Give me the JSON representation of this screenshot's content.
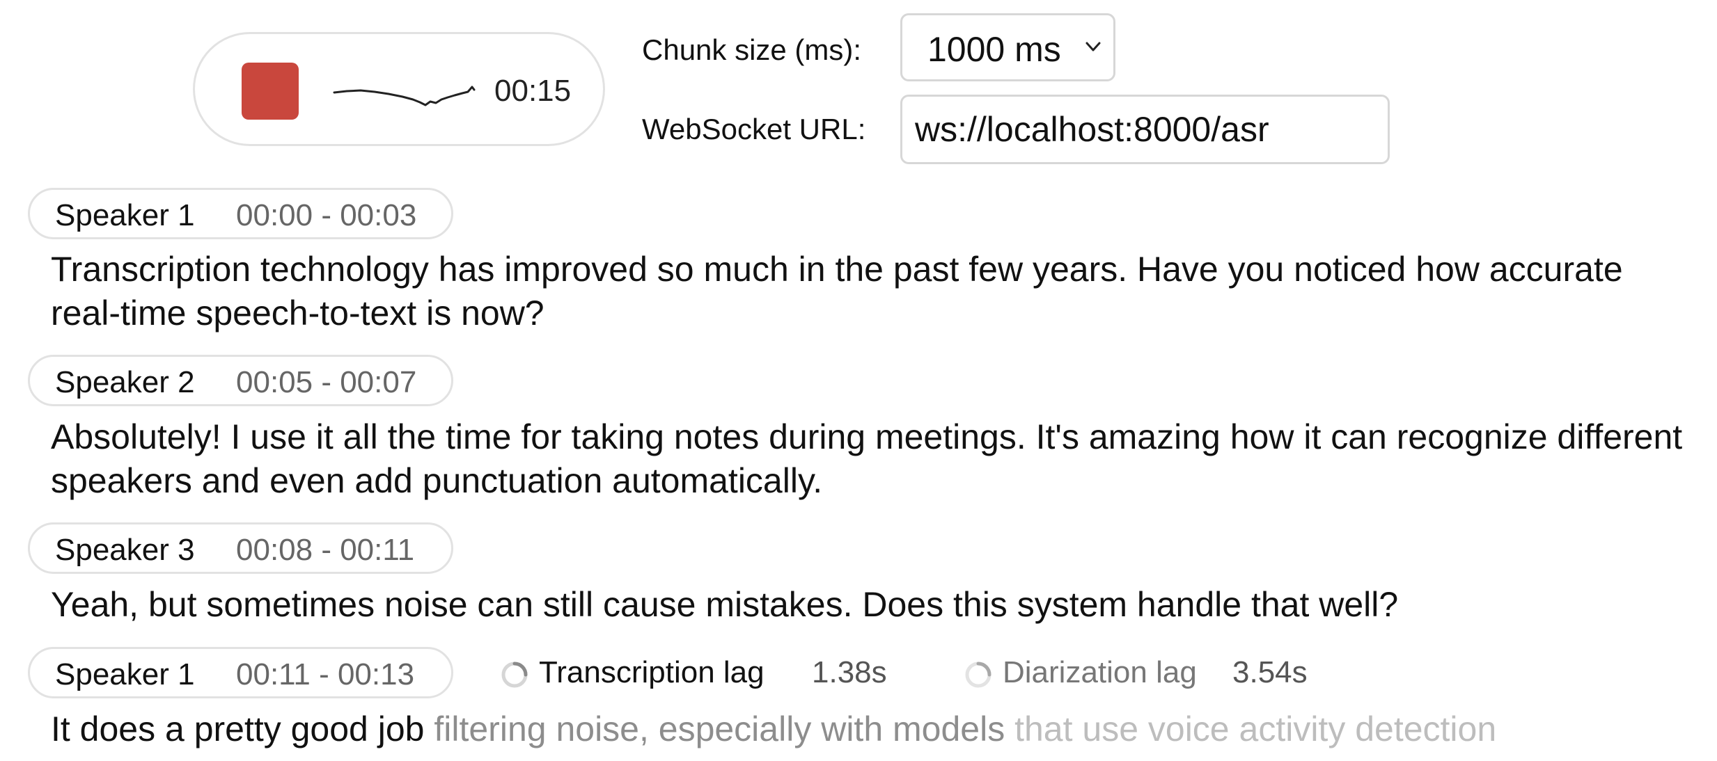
{
  "recorder": {
    "stop_icon": "stop-square-icon",
    "waveform_icon": "waveform-icon",
    "elapsed": "00:15",
    "colors": {
      "stop": "#c9473d"
    }
  },
  "settings": {
    "chunk_label": "Chunk size (ms):",
    "chunk_value": "1000 ms",
    "ws_label": "WebSocket URL:",
    "ws_value": "ws://localhost:8000/asr"
  },
  "transcript": [
    {
      "speaker": "Speaker 1",
      "time": "00:00 - 00:03",
      "text": "Transcription technology has improved so much in the past few years. Have you noticed how accurate real-time speech-to-text is now?"
    },
    {
      "speaker": "Speaker 2",
      "time": "00:05 - 00:07",
      "text": "Absolutely! I use it all the time for taking notes during meetings. It's amazing how it can recognize different speakers and even add punctuation automatically."
    },
    {
      "speaker": "Speaker 3",
      "time": "00:08 - 00:11",
      "text": "Yeah, but sometimes noise can still cause mistakes. Does this system handle that well?"
    },
    {
      "speaker": "Speaker 1",
      "time": "00:11 - 00:13",
      "text": "It does a pretty good job",
      "buffer_diarization": " filtering noise, especially with models",
      "buffer_transcription": " that use voice activity detection"
    }
  ],
  "lag": {
    "transcription_label": "Transcription lag",
    "transcription_value": "1.38s",
    "diarization_label": "Diarization lag",
    "diarization_value": "3.54s",
    "spinner_icon": "spinner-icon"
  }
}
